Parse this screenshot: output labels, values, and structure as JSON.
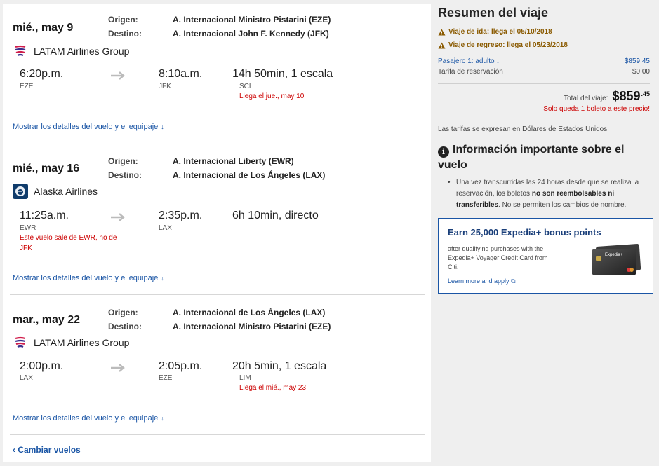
{
  "flights": [
    {
      "date": "mié., may 9",
      "origin_label": "Origen:",
      "origin": "A. Internacional Ministro Pistarini (EZE)",
      "destination_label": "Destino:",
      "destination": "A. Internacional John F. Kennedy (JFK)",
      "airline": "LATAM Airlines Group",
      "airline_icon": "latam-logo",
      "depart_time": "6:20p.m.",
      "depart_code": "EZE",
      "depart_note": "",
      "arrive_time": "8:10a.m.",
      "arrive_code": "JFK",
      "duration": "14h 50min, 1 escala",
      "stop_code": "SCL",
      "arrival_note": "Llega el jue., may 10",
      "details_link": "Mostrar los detalles del vuelo y el equipaje"
    },
    {
      "date": "mié., may 16",
      "origin_label": "Origen:",
      "origin": "A. Internacional Liberty (EWR)",
      "destination_label": "Destino:",
      "destination": "A. Internacional de Los Ángeles (LAX)",
      "airline": "Alaska Airlines",
      "airline_icon": "alaska-logo",
      "depart_time": "11:25a.m.",
      "depart_code": "EWR",
      "depart_note": "Este vuelo sale de EWR, no de JFK",
      "arrive_time": "2:35p.m.",
      "arrive_code": "LAX",
      "duration": "6h 10min, directo",
      "stop_code": "",
      "arrival_note": "",
      "details_link": "Mostrar los detalles del vuelo y el equipaje"
    },
    {
      "date": "mar., may 22",
      "origin_label": "Origen:",
      "origin": "A. Internacional de Los Ángeles (LAX)",
      "destination_label": "Destino:",
      "destination": "A. Internacional Ministro Pistarini (EZE)",
      "airline": "LATAM Airlines Group",
      "airline_icon": "latam-logo",
      "depart_time": "2:00p.m.",
      "depart_code": "LAX",
      "depart_note": "",
      "arrive_time": "2:05p.m.",
      "arrive_code": "EZE",
      "duration": "20h 5min, 1 escala",
      "stop_code": "LIM",
      "arrival_note": "Llega el mié., may 23",
      "details_link": "Mostrar los detalles del vuelo y el equipaje"
    }
  ],
  "change_flights": "Cambiar vuelos",
  "summary": {
    "title": "Resumen del viaje",
    "outbound_warning": "Viaje de ida: llega el 05/10/2018",
    "return_warning": "Viaje de regreso: llega el 05/23/2018",
    "passenger_label": "Pasajero 1: adulto",
    "passenger_price": "$859.45",
    "booking_fee_label": "Tarifa de reservación",
    "booking_fee": "$0.00",
    "total_label": "Total del viaje:",
    "total_dollars": "$859",
    "total_cents": ".45",
    "only_left": "¡Solo queda 1 boleto a este precio!",
    "currency_note": "Las tarifas se expresan en Dólares de Estados Unidos"
  },
  "info": {
    "title": "Información importante sobre el vuelo",
    "bullet_pre": "Una vez transcurridas las 24 horas desde que se realiza la reservación, los boletos ",
    "bullet_bold": "no son reembolsables ni transferibles",
    "bullet_post": ". No se permiten los cambios de nombre."
  },
  "promo": {
    "title": "Earn 25,000 Expedia+ bonus points",
    "text": "after qualifying purchases with the Expedia+ Voyager Credit Card from Citi.",
    "link": "Learn more and apply",
    "card_text": "Expedia+"
  },
  "colors": {
    "link": "#1a55a5",
    "alert_red": "#cc0000",
    "warning": "#8a5a00"
  }
}
